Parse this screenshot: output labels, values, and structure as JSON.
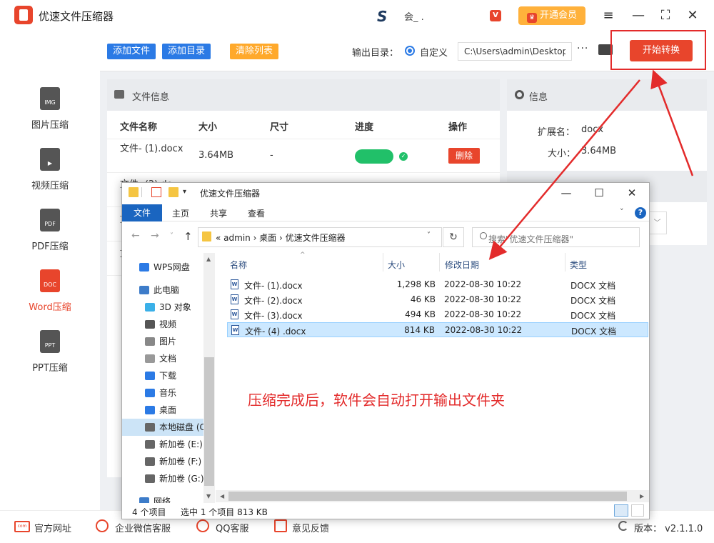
{
  "app": {
    "title": "优速文件压缩器",
    "user_name": "会_ .",
    "vip_badge": "V",
    "vip_label": "开通会员",
    "crown": "♛",
    "window_controls": {
      "menu": "≡",
      "minimize": "—",
      "maximize": "⛶",
      "close": "✕"
    }
  },
  "sidebar": {
    "items": [
      {
        "label": "图片压缩",
        "icon_text": "IMG",
        "active": false
      },
      {
        "label": "视频压缩",
        "icon_text": "▶",
        "active": false
      },
      {
        "label": "PDF压缩",
        "icon_text": "PDF",
        "active": false
      },
      {
        "label": "Word压缩",
        "icon_text": "DOC",
        "active": true
      },
      {
        "label": "PPT压缩",
        "icon_text": "PPT",
        "active": false
      }
    ]
  },
  "toolbar": {
    "add_file": "添加文件",
    "add_dir": "添加目录",
    "clear_list": "清除列表",
    "output_label": "输出目录：",
    "radio_label": "自定义",
    "path_value": "C:\\Users\\admin\\Desktop",
    "more": "···",
    "start": "开始转换"
  },
  "file_panel": {
    "title": "文件信息",
    "columns": {
      "name": "文件名称",
      "size": "大小",
      "dimension": "尺寸",
      "progress": "进度",
      "action": "操作"
    },
    "rows": [
      {
        "name": "文件- (1).docx",
        "size": "3.64MB",
        "dimension": "-",
        "action": "删除",
        "check": "✓"
      }
    ],
    "stub_rows": [
      "文件- (2).do",
      "文",
      "文"
    ]
  },
  "info_panel": {
    "title": "信息",
    "ext_label": "扩展名：",
    "ext_value": "docx",
    "size_label": "大小：",
    "size_value": "3.64MB",
    "select_caret": "﹀"
  },
  "footer": {
    "web_icon": "com",
    "links": [
      "官方网址",
      "企业微信客服",
      "QQ客服",
      "意见反馈"
    ],
    "version": "版本： v2.1.1.0"
  },
  "explorer": {
    "title": "优速文件压缩器",
    "qa_caret": "▾",
    "tabs": {
      "file": "文件",
      "home": "主页",
      "share": "共享",
      "view": "查看"
    },
    "help": "?",
    "collapse": "˅",
    "nav": {
      "back": "←",
      "forward": "→",
      "recent": "˅",
      "up": "↑",
      "addr_drop": "˅",
      "refresh": "↻"
    },
    "address": "«  admin  ›  桌面  ›  优速文件压缩器",
    "search_placeholder": "搜索\"优速文件压缩器\"",
    "window_controls": {
      "minimize": "—",
      "maximize": "☐",
      "close": "✕"
    },
    "nav_items": [
      {
        "label": "WPS网盘",
        "color": "#2b7ae5"
      },
      {
        "label": "此电脑",
        "color": "#3d7cc9"
      },
      {
        "label": "3D 对象",
        "color": "#3ab0e8"
      },
      {
        "label": "视频",
        "color": "#555555"
      },
      {
        "label": "图片",
        "color": "#888888"
      },
      {
        "label": "文档",
        "color": "#999999"
      },
      {
        "label": "下载",
        "color": "#2b7ae5"
      },
      {
        "label": "音乐",
        "color": "#2b7ae5"
      },
      {
        "label": "桌面",
        "color": "#2b7ae5"
      },
      {
        "label": "本地磁盘 (C",
        "color": "#666666"
      },
      {
        "label": "新加卷 (E:)",
        "color": "#666666"
      },
      {
        "label": "新加卷 (F:)",
        "color": "#666666"
      },
      {
        "label": "新加卷 (G:)",
        "color": "#666666"
      },
      {
        "label": "网络",
        "color": "#3d7cc9"
      }
    ],
    "columns": {
      "name": "名称",
      "size": "大小",
      "date": "修改日期",
      "type": "类型"
    },
    "sort_arrow": "^",
    "scroll": {
      "up": "▲",
      "down": "▼",
      "left": "◀",
      "right": "▶"
    },
    "files": [
      {
        "name": "文件- (1).docx",
        "size": "1,298 KB",
        "date": "2022-08-30 10:22",
        "type": "DOCX 文档",
        "selected": false
      },
      {
        "name": "文件- (2).docx",
        "size": "46 KB",
        "date": "2022-08-30 10:22",
        "type": "DOCX 文档",
        "selected": false
      },
      {
        "name": "文件- (3).docx",
        "size": "494 KB",
        "date": "2022-08-30 10:22",
        "type": "DOCX 文档",
        "selected": false
      },
      {
        "name": "文件- (4) .docx",
        "size": "814 KB",
        "date": "2022-08-30 10:22",
        "type": "DOCX 文档",
        "selected": true
      }
    ],
    "file_icon_letter": "W",
    "status_count": "4 个项目",
    "status_selected": "选中 1 个项目  813 KB"
  },
  "annotation": "压缩完成后，软件会自动打开输出文件夹"
}
